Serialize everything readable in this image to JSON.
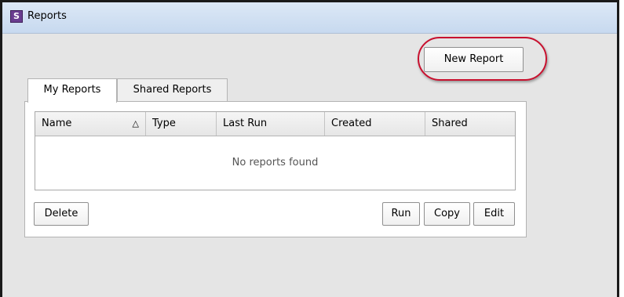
{
  "window": {
    "title": "Reports",
    "app_icon_letter": "S"
  },
  "toolbar": {
    "new_report_label": "New Report"
  },
  "tabs": [
    {
      "label": "My Reports",
      "active": true
    },
    {
      "label": "Shared Reports",
      "active": false
    }
  ],
  "table": {
    "columns": [
      "Name",
      "Type",
      "Last Run",
      "Created",
      "Shared"
    ],
    "sort_indicator": "△",
    "empty_message": "No reports found"
  },
  "actions": {
    "delete_label": "Delete",
    "run_label": "Run",
    "copy_label": "Copy",
    "edit_label": "Edit"
  },
  "colors": {
    "highlight": "#c8102e",
    "titlebar": "#c7d9ef",
    "background": "#e5e5e5"
  }
}
